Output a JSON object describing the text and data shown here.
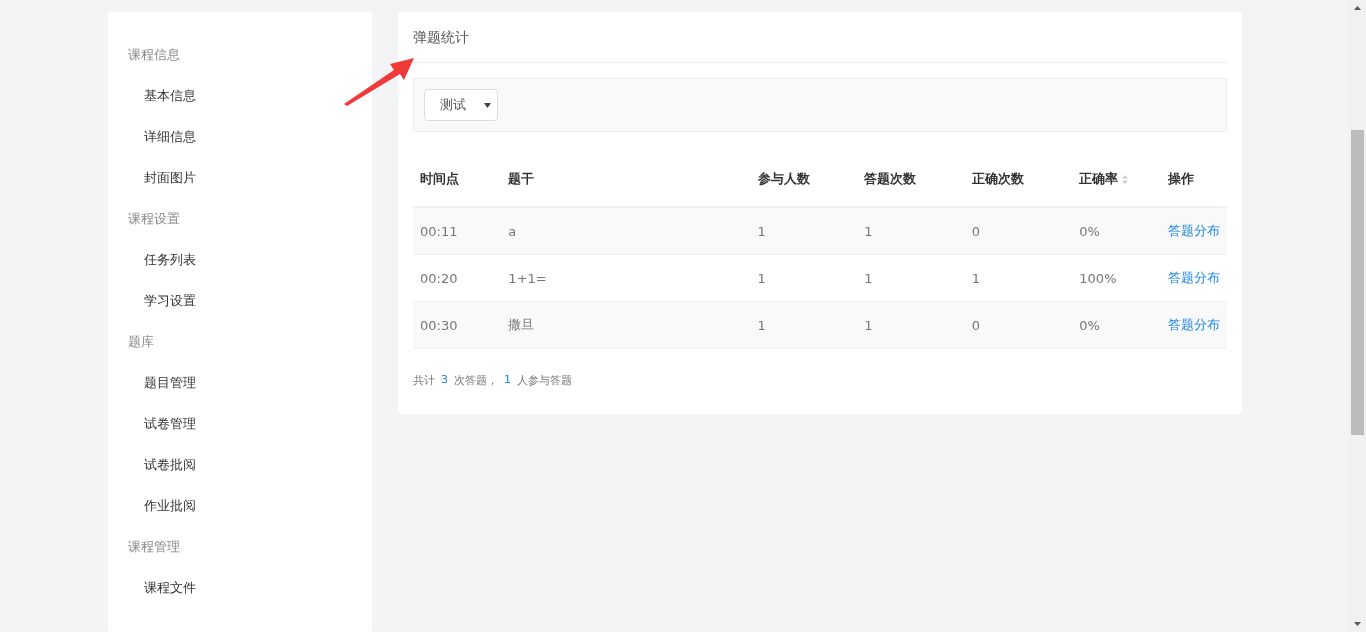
{
  "sidebar": {
    "groups": [
      {
        "title": "课程信息",
        "items": [
          "基本信息",
          "详细信息",
          "封面图片"
        ]
      },
      {
        "title": "课程设置",
        "items": [
          "任务列表",
          "学习设置"
        ]
      },
      {
        "title": "题库",
        "items": [
          "题目管理",
          "试卷管理",
          "试卷批阅",
          "作业批阅"
        ]
      },
      {
        "title": "课程管理",
        "items": [
          "课程文件"
        ]
      }
    ]
  },
  "panel": {
    "title": "弹题统计",
    "filter": {
      "value": "测试"
    },
    "table": {
      "columns": [
        {
          "label": "时间点",
          "sortable": false
        },
        {
          "label": "题干",
          "sortable": false
        },
        {
          "label": "参与人数",
          "sortable": false
        },
        {
          "label": "答题次数",
          "sortable": false
        },
        {
          "label": "正确次数",
          "sortable": false
        },
        {
          "label": "正确率",
          "sortable": true
        },
        {
          "label": "操作",
          "sortable": false
        }
      ],
      "rows": [
        {
          "cells": [
            "00:11",
            "a",
            "1",
            "1",
            "0",
            "0%"
          ],
          "action": "答题分布"
        },
        {
          "cells": [
            "00:20",
            "1+1=",
            "1",
            "1",
            "1",
            "100%"
          ],
          "action": "答题分布"
        },
        {
          "cells": [
            "00:30",
            "撒旦",
            "1",
            "1",
            "0",
            "0%"
          ],
          "action": "答题分布"
        }
      ]
    },
    "summary": [
      {
        "text": "共计",
        "highlight": false
      },
      {
        "text": "3",
        "highlight": true
      },
      {
        "text": "次答题，",
        "highlight": false
      },
      {
        "text": "1",
        "highlight": true
      },
      {
        "text": "人参与答题",
        "highlight": false
      }
    ]
  }
}
